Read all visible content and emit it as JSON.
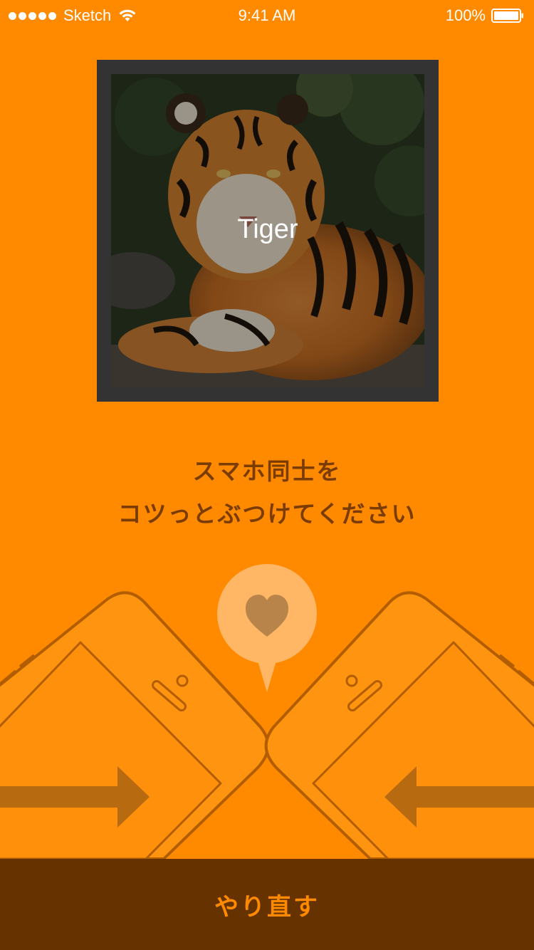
{
  "status_bar": {
    "carrier": "Sketch",
    "time": "9:41 AM",
    "battery": "100%",
    "signal_icon": "signal-dots-icon",
    "wifi_icon": "wifi-icon",
    "battery_icon": "battery-icon"
  },
  "photo": {
    "caption": "Tiger",
    "subject": "tiger-photo"
  },
  "instruction": {
    "line1": "スマホ同士を",
    "line2": "コツっとぶつけてください"
  },
  "illustration": {
    "left_phone": "phone-left-icon",
    "right_phone": "phone-right-icon",
    "bubble_icon": "heart-icon",
    "left_arrow": "arrow-right-icon",
    "right_arrow": "arrow-left-icon"
  },
  "retry_button": {
    "label": "やり直す"
  },
  "colors": {
    "background": "#FF8A00",
    "text_dark": "#7A3C00",
    "bottom_bar": "#663300",
    "card_frame": "#333333",
    "bubble": "#FFB766"
  }
}
